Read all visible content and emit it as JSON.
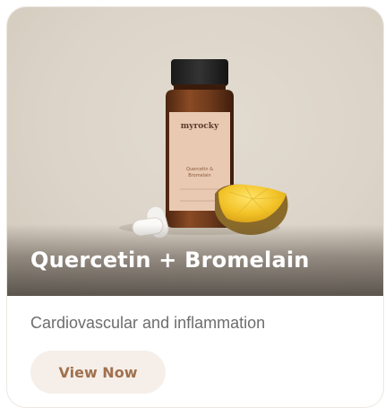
{
  "card": {
    "title": "Quercetin + Bromelain",
    "description": "Cardiovascular and inflammation",
    "cta_label": "View Now"
  },
  "product_image": {
    "brand_text": "myrocky",
    "brand_tagline": "",
    "label_name_line1": "Quercetin &",
    "label_name_line2": "Bromelain",
    "accessory": "pineapple-slice",
    "capsules": "white-capsules"
  },
  "colors": {
    "hero_bg": "#dcd4c8",
    "bottle": "#6e3a1c",
    "label": "#e9c9b2",
    "cta_bg": "#f6efe9",
    "cta_text": "#a0714e",
    "subtitle": "#6d6d6d"
  }
}
